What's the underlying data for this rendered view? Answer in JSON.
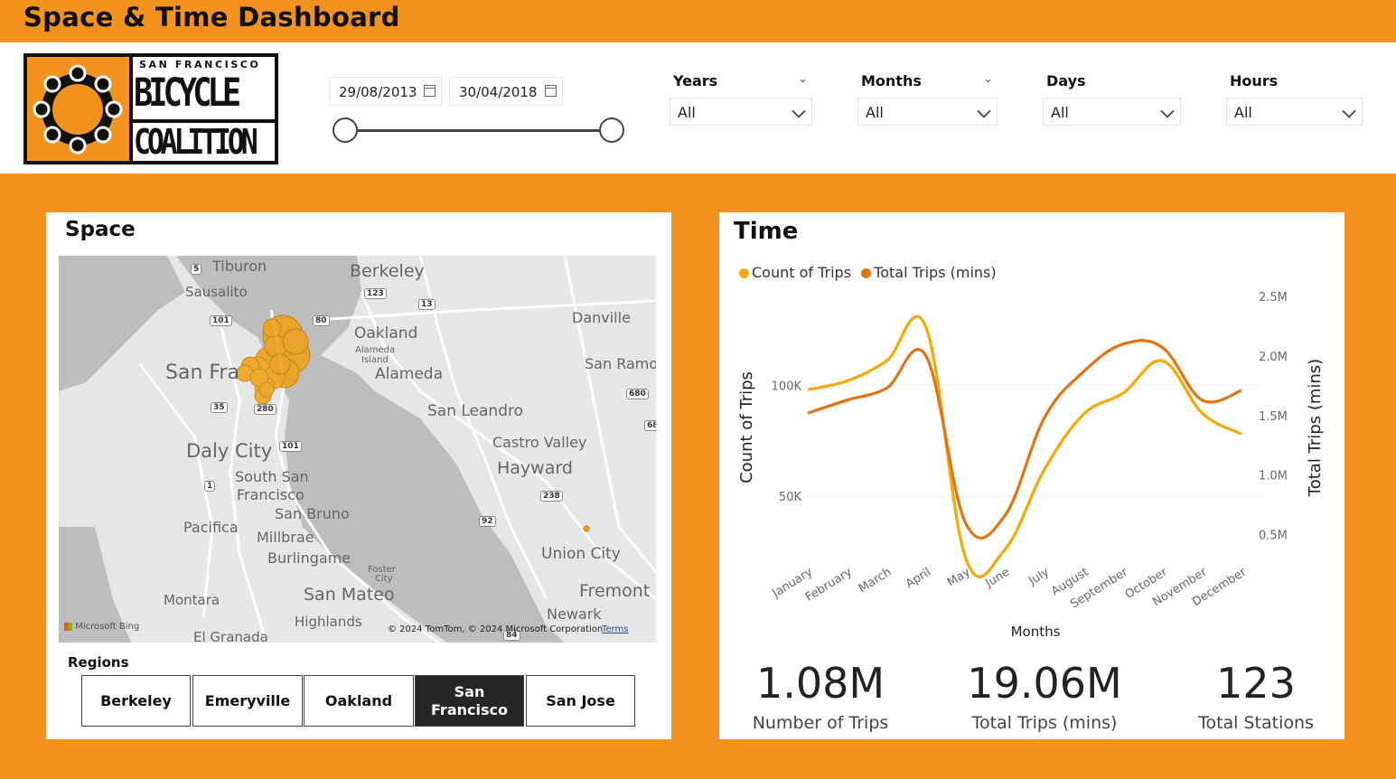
{
  "header": {
    "title": "Space & Time Dashboard"
  },
  "logo": {
    "top_text": "SAN FRANCISCO",
    "line1": "BICYCLE",
    "line2": "COALITION"
  },
  "date_range": {
    "start": "29/08/2013",
    "end": "30/04/2018"
  },
  "slicers": [
    {
      "label": "Years",
      "value": "All"
    },
    {
      "label": "Months",
      "value": "All"
    },
    {
      "label": "Days",
      "value": "All"
    },
    {
      "label": "Hours",
      "value": "All"
    }
  ],
  "space": {
    "title": "Space",
    "map_labels": [
      "Tiburon",
      "Berkeley",
      "Sausalito",
      "Danville",
      "Oakland",
      "San Fra",
      "Alameda",
      "San Ramo",
      "San Leandro",
      "Daly City",
      "Castro Valley",
      "Hayward",
      "South San",
      "Francisco",
      "San Bruno",
      "Pacifica",
      "Millbrae",
      "Burlingame",
      "Union City",
      "Montara",
      "San Mateo",
      "Fremont",
      "Newark",
      "Highlands",
      "El Granada",
      "Alameda",
      "Island",
      "Foster",
      "City"
    ],
    "road_shields": [
      "5",
      "123",
      "13",
      "101",
      "80",
      "680",
      "35",
      "280",
      "101",
      "1",
      "238",
      "92",
      "68",
      "84"
    ],
    "attribution": {
      "bing": "Microsoft Bing",
      "copyright": "© 2024 TomTom, © 2024 Microsoft Corporation",
      "terms": "Terms"
    },
    "regions_label": "Regions",
    "regions": [
      {
        "label": "Berkeley",
        "selected": false
      },
      {
        "label": "Emeryville",
        "selected": false
      },
      {
        "label": "Oakland",
        "selected": false
      },
      {
        "label": "San Francisco",
        "selected": true
      },
      {
        "label": "San Jose",
        "selected": false
      }
    ]
  },
  "time": {
    "title": "Time",
    "legend": [
      {
        "name": "Count of Trips",
        "color": "#f5a800"
      },
      {
        "name": "Total Trips (mins)",
        "color": "#e3730e"
      }
    ]
  },
  "chart_data": {
    "type": "line",
    "xlabel": "Months",
    "ylabel": "Count of Trips",
    "y2label": "Total Trips (mins)",
    "categories": [
      "January",
      "February",
      "March",
      "April",
      "May",
      "June",
      "July",
      "August",
      "September",
      "October",
      "November",
      "December"
    ],
    "left_ticks": [
      "100K",
      "50K"
    ],
    "right_ticks": [
      "2.5M",
      "2.0M",
      "1.5M",
      "1.0M",
      "0.5M"
    ],
    "ylim": [
      22000,
      140000
    ],
    "y2lim": [
      0.3,
      2.5
    ],
    "grid": true,
    "series": [
      {
        "name": "Count of Trips",
        "axis": "left",
        "color": "#f5a800",
        "values": [
          98000,
          102000,
          111000,
          126000,
          22400,
          26000,
          62000,
          87000,
          96500,
          111000,
          87500,
          78000
        ]
      },
      {
        "name": "Total Trips (mins)",
        "axis": "right",
        "color": "#e3730e",
        "values": [
          1.52,
          1.63,
          1.73,
          2.0,
          0.6,
          0.66,
          1.48,
          1.87,
          2.1,
          2.07,
          1.63,
          1.71
        ]
      }
    ]
  },
  "kpis": [
    {
      "value": "1.08M",
      "label": "Number of Trips"
    },
    {
      "value": "19.06M",
      "label": "Total Trips (mins)"
    },
    {
      "value": "123",
      "label": "Total Stations"
    }
  ]
}
